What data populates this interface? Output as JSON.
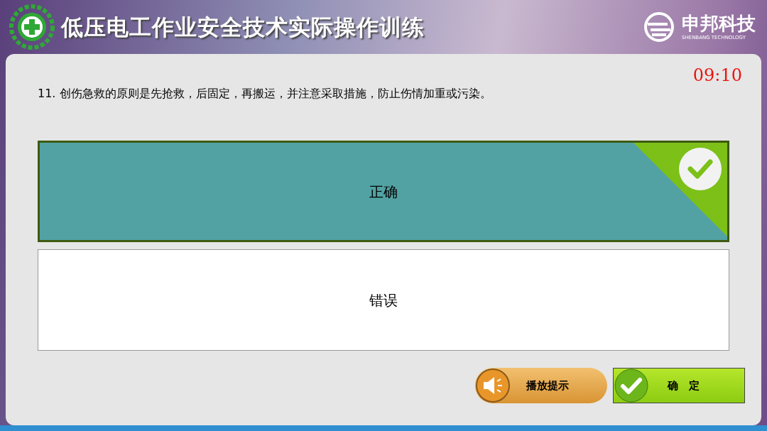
{
  "header": {
    "title": "低压电工作业安全技术实际操作训练",
    "brand": "申邦科技",
    "brand_sub": "SHENBANG TECHNOLOGY"
  },
  "timer": "09:10",
  "question": "11. 创伤急救的原则是先抢救，后固定，再搬运，并注意采取措施，防止伤情加重或污染。",
  "options": [
    {
      "label": "正确",
      "selected": true
    },
    {
      "label": "错误",
      "selected": false
    }
  ],
  "buttons": {
    "hint": "播放提示",
    "confirm": "确　定"
  }
}
